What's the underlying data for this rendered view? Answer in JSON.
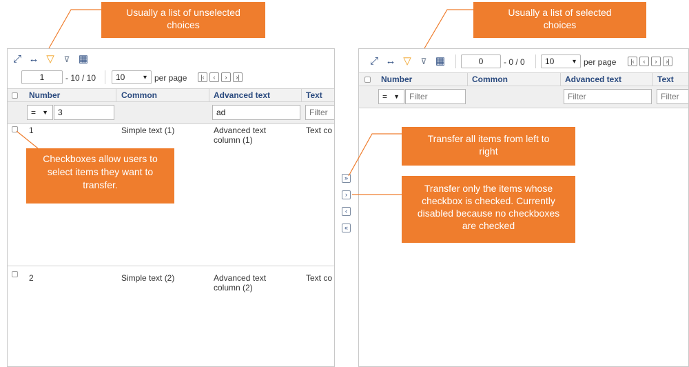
{
  "colors": {
    "accent": "#ef7d2d",
    "header_text": "#2a4a7f",
    "filter_icon": "#f0a020"
  },
  "icons": [
    "expand-icon",
    "fit-width-icon",
    "filter-icon",
    "clear-filter-icon",
    "table-grid-icon"
  ],
  "callouts": {
    "left_list": "Usually a list of unselected choices",
    "right_list": "Usually a list of selected choices",
    "checkboxes": "Checkboxes allow users to select items they want to transfer.",
    "transfer_all": "Transfer all items from left to right",
    "transfer_checked": "Transfer only the items whose checkbox is checked. Currently disabled because no checkboxes are checked"
  },
  "left": {
    "page_number": "1",
    "range": "- 10 / 10",
    "page_size": "10",
    "page_size_arrow": "▾",
    "per_page": "per page",
    "columns": [
      "Number",
      "Common",
      "Advanced text",
      "Text"
    ],
    "filter": {
      "operator": "=",
      "number_value": "3",
      "advanced_value": "ad",
      "text_placeholder": "Filter"
    },
    "rows": [
      {
        "number": "1",
        "common": "Simple text (1)",
        "advanced_1": "Advanced text",
        "advanced_2": "column (1)",
        "text": "Text co"
      },
      {
        "number": "2",
        "common": "Simple text (2)",
        "advanced_1": "Advanced text",
        "advanced_2": "column (2)",
        "text": "Text co"
      }
    ]
  },
  "right": {
    "page_number": "0",
    "range": "- 0 / 0",
    "page_size": "10",
    "page_size_arrow": "▾",
    "per_page": "per page",
    "columns": [
      "Number",
      "Common",
      "Advanced text",
      "Text"
    ],
    "filter": {
      "operator": "=",
      "number_placeholder": "Filter",
      "advanced_placeholder": "Filter",
      "text_placeholder": "Filter"
    }
  },
  "pager_buttons": {
    "first": "|‹",
    "prev": "‹",
    "next": "›",
    "last": "›|"
  },
  "transfer_buttons": {
    "all_right": "»",
    "checked_right": "›",
    "checked_left": "‹",
    "all_left": "«"
  }
}
